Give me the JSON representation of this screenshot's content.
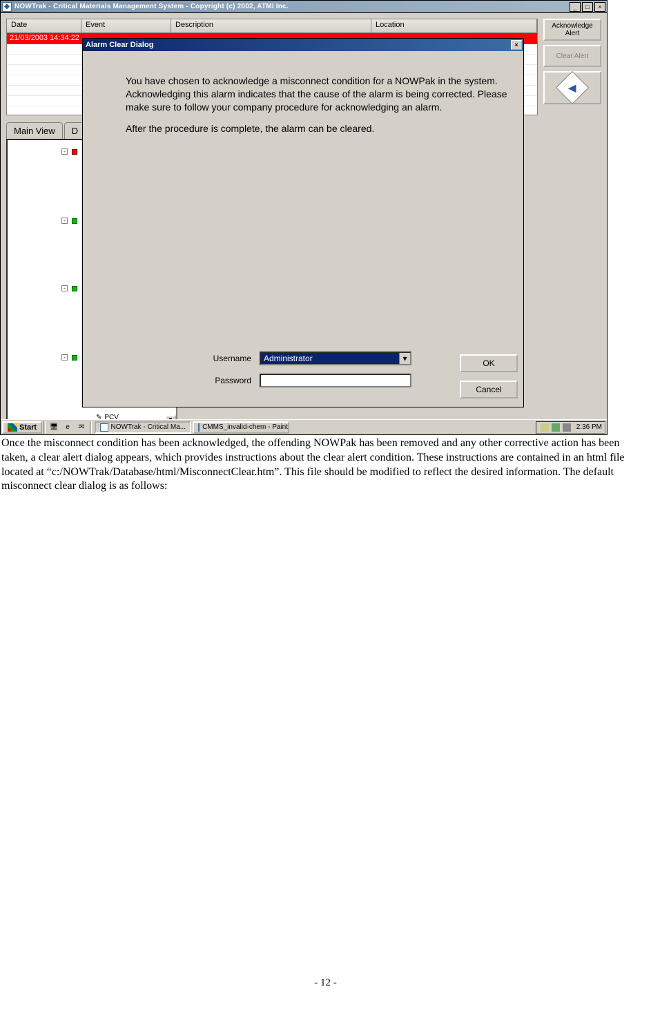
{
  "app_window": {
    "title": "NOWTrak - Critical Materials Management System - Copyright (c) 2002, ATMI Inc."
  },
  "alert_table": {
    "columns": [
      "Date",
      "Event",
      "Description",
      "Location"
    ],
    "row": {
      "date": "21/03/2003  14:34:22",
      "event": "",
      "description": "",
      "location": ""
    }
  },
  "side": {
    "ack_label": "Acknowledge Alert",
    "clear_label": "Clear Alert"
  },
  "tabs": {
    "main_view": "Main View",
    "second": "D"
  },
  "tree": {
    "leaf_label": "PCV"
  },
  "taskbar": {
    "start": "Start",
    "task1": "NOWTrak - Critical Ma...",
    "task2": "CMMS_invalid-chem - Paint",
    "clock": "2:36 PM"
  },
  "dialog": {
    "title": "Alarm Clear Dialog",
    "para1": "You have chosen to acknowledge a misconnect condition for a NOWPak in the system. Acknowledging this alarm indicates that the cause of the alarm is being corrected. Please make sure to follow your company procedure for acknowledging an alarm.",
    "para2": "After the procedure is complete, the alarm can be cleared.",
    "username_label": "Username",
    "password_label": "Password",
    "username_value": "Administrator",
    "ok": "OK",
    "cancel": "Cancel"
  },
  "doc": {
    "paragraph": "Once the misconnect condition has been acknowledged, the offending NOWPak has been removed and any other corrective action has been taken, a clear alert dialog appears, which provides instructions about the clear alert condition.  These instructions are contained in an html file located at “c:/NOWTrak/Database/html/MisconnectClear.htm”.  This file should be modified to reflect the desired information.  The default misconnect clear dialog is as follows:",
    "page_number": "- 12 -"
  }
}
